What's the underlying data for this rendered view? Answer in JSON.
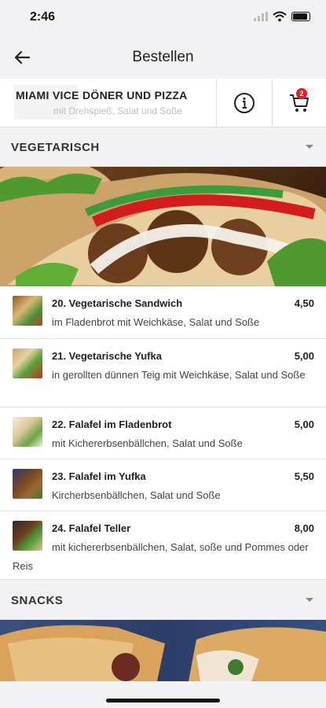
{
  "status": {
    "time": "2:46"
  },
  "appbar": {
    "title": "Bestellen"
  },
  "restaurant": {
    "name": "MIAMI VICE DÖNER UND PIZZA",
    "faint_subtitle": "mit Drehspieß, Salat und Soße",
    "cart_count": "2",
    "cart_faint": "0"
  },
  "categories": [
    {
      "title": "VEGETARISCH"
    },
    {
      "title": "SNACKS"
    }
  ],
  "items": [
    {
      "name": "20. Vegetarische Sandwich",
      "price": "4,50",
      "desc": "im Fladenbrot mit Weichkäse, Salat und Soße"
    },
    {
      "name": "21. Vegetarische Yufka",
      "price": "5,00",
      "desc": "in gerollten dünnen Teig mit Weichkäse, Salat und Soße"
    },
    {
      "name": "22. Falafel im Fladenbrot",
      "price": "5,00",
      "desc": "mit Kichererbsenbällchen, Salat und Soße"
    },
    {
      "name": "23. Falafel im Yufka",
      "price": "5,50",
      "desc": "Kircherbsenbällchen, Salat und Soße"
    },
    {
      "name": "24. Falafel Teller",
      "price": "8,00",
      "desc": "mit kichererbsenbällchen, Salat, soße und Pommes oder Reis"
    }
  ],
  "colors": {
    "badge": "#e0202b",
    "background": "#f2f2f4"
  }
}
